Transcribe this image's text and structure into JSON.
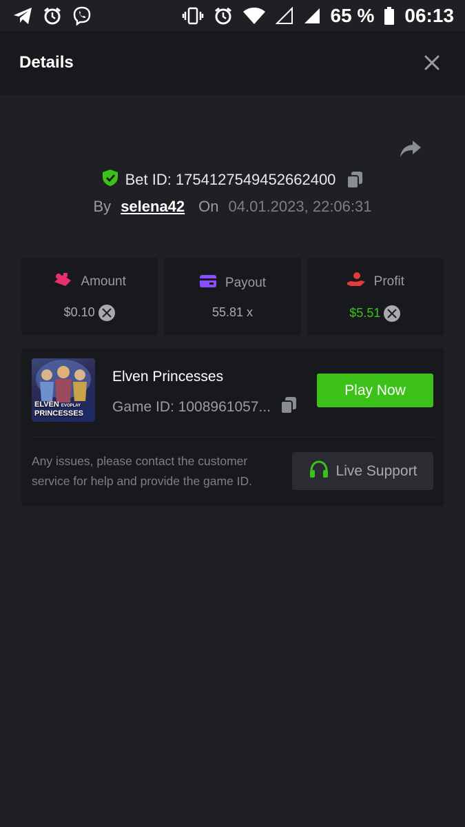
{
  "status_bar": {
    "battery_percent": "65 %",
    "time": "06:13",
    "icons_left": [
      "telegram-icon",
      "alarm-icon",
      "viber-icon"
    ],
    "icons_right": [
      "vibrate-icon",
      "alarm-icon",
      "wifi-icon",
      "signal-empty-icon",
      "signal-icon",
      "battery-icon"
    ]
  },
  "header": {
    "title": "Details"
  },
  "bet": {
    "id_label": "Bet ID: 1754127549452662400",
    "by_label": "By",
    "user": "selena42",
    "on_label": "On",
    "date": "04.01.2023, 22:06:31"
  },
  "stats": {
    "amount": {
      "label": "Amount",
      "value": "$0.10"
    },
    "payout": {
      "label": "Payout",
      "value": "55.81 x"
    },
    "profit": {
      "label": "Profit",
      "value": "$5.51"
    }
  },
  "game": {
    "name": "Elven Princesses",
    "id_label": "Game ID: 1008961057...",
    "thumb_title_line1": "ELVEN",
    "thumb_brand": "EVOPLAY",
    "thumb_title_line2": "PRINCESSES",
    "play_label": "Play Now",
    "support_text": "Any issues, please contact the customer service for help and provide the game ID.",
    "support_button": "Live Support"
  },
  "colors": {
    "accent_green": "#3bc117",
    "amount_icon": "#e8316a",
    "payout_icon": "#8a4dff",
    "profit_icon": "#e43a3a"
  }
}
